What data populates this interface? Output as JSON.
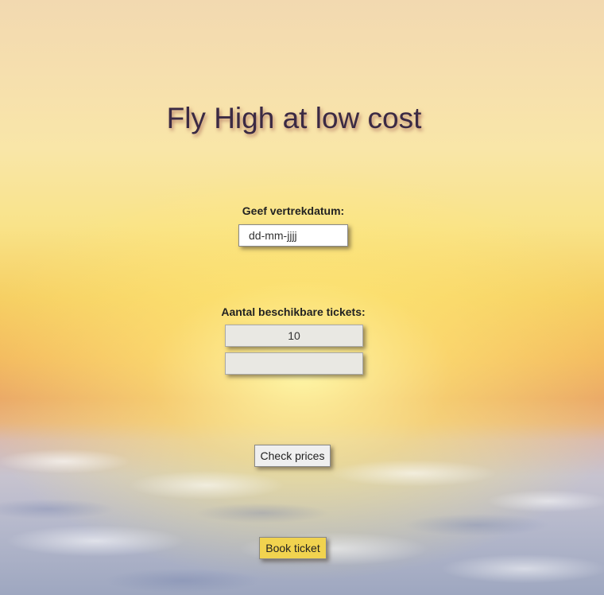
{
  "page": {
    "title": "Fly High at low cost"
  },
  "departure": {
    "label": "Geef vertrekdatum:",
    "placeholder": "dd-mm-jjjj"
  },
  "tickets": {
    "label": "Aantal beschikbare tickets:",
    "available": "10",
    "second_value": ""
  },
  "actions": {
    "check_label": "Check prices",
    "book_label": "Book ticket"
  },
  "colors": {
    "book_button": "#f1d34f",
    "title_text": "#3b2a44"
  }
}
